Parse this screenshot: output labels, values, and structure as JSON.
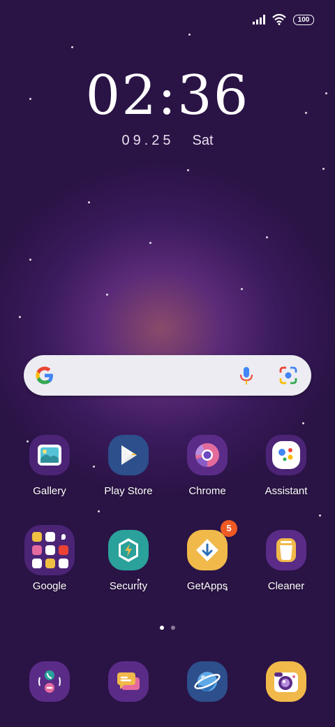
{
  "status_bar": {
    "battery": "100"
  },
  "lockscreen": {
    "time": "02:36",
    "date": "09.25",
    "weekday": "Sat"
  },
  "search": {
    "google_letter": "G"
  },
  "apps_row1": [
    {
      "label": "Gallery"
    },
    {
      "label": "Play Store"
    },
    {
      "label": "Chrome"
    },
    {
      "label": "Assistant"
    }
  ],
  "apps_row2": [
    {
      "label": "Google"
    },
    {
      "label": "Security"
    },
    {
      "label": "GetApps",
      "badge": "5"
    },
    {
      "label": "Cleaner"
    }
  ],
  "colors": {
    "icon_bg_purple": "#4b2476",
    "security_teal": "#2aa19a",
    "getapps_gold": "#f0b94a",
    "badge_orange": "#f05a24"
  }
}
